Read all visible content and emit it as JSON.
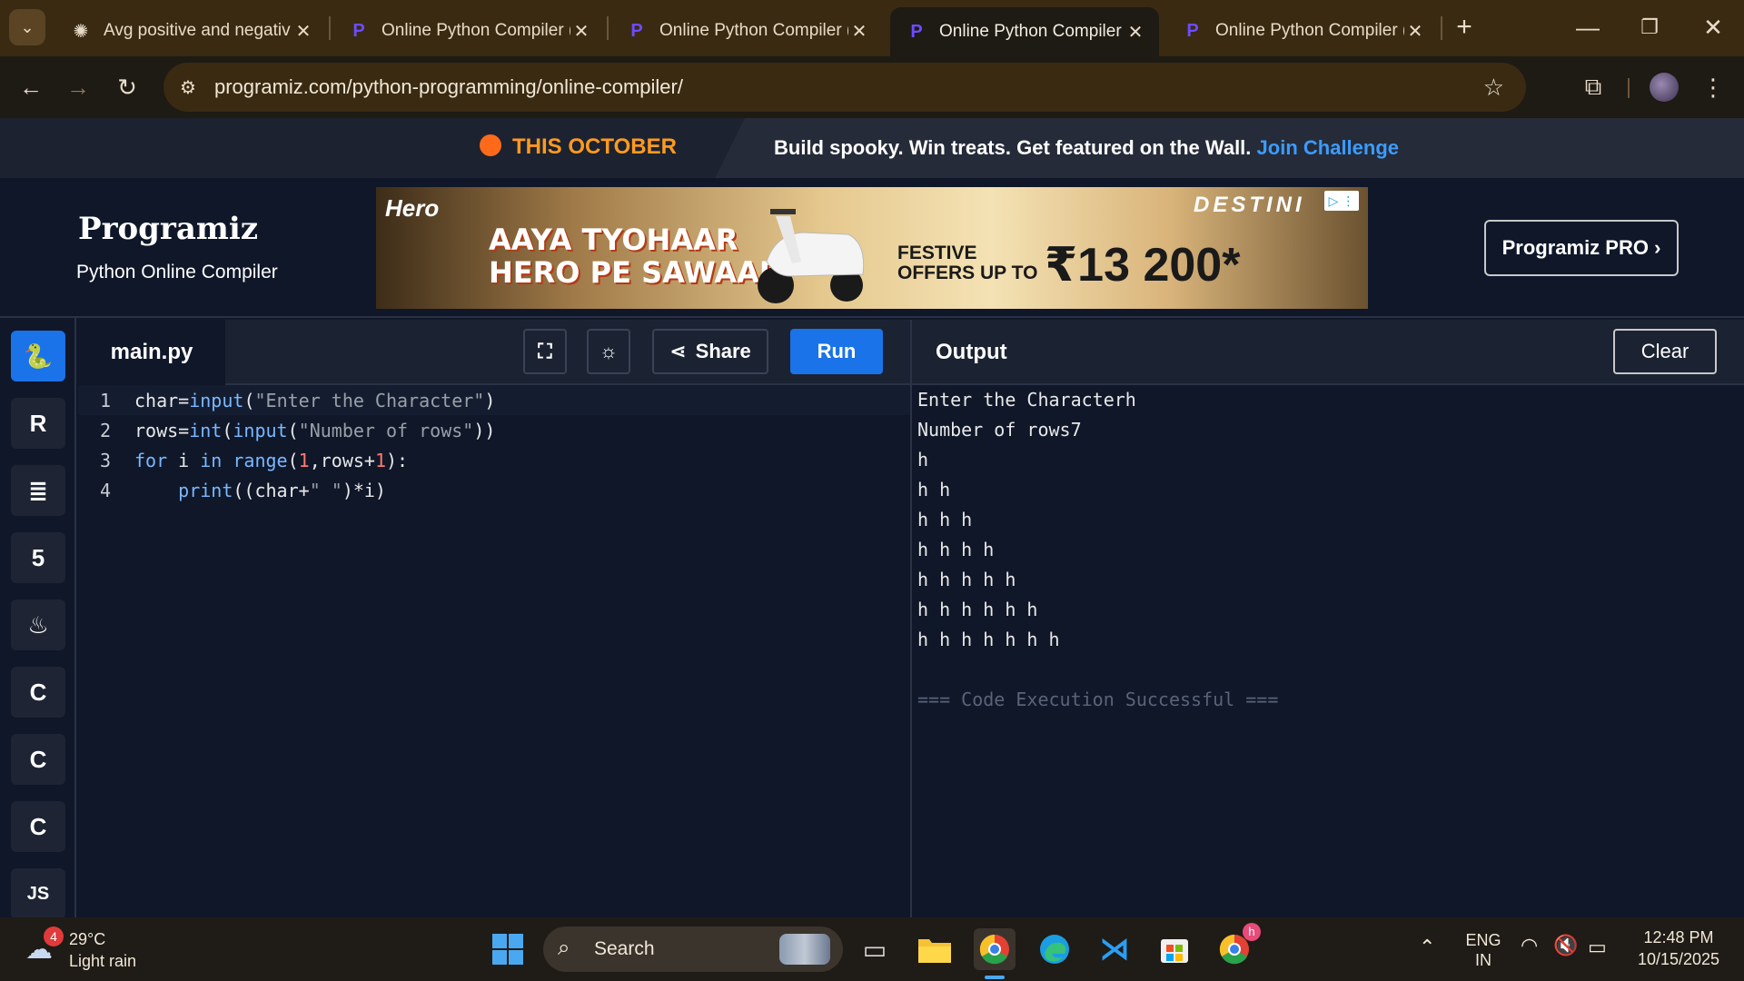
{
  "browser": {
    "tabs": [
      {
        "title": "Avg positive and negativ",
        "active": false
      },
      {
        "title": "Online Python Compiler (",
        "active": false
      },
      {
        "title": "Online Python Compiler (",
        "active": false
      },
      {
        "title": "Online Python Compiler (",
        "active": true
      },
      {
        "title": "Online Python Compiler (",
        "active": false
      }
    ],
    "url": "programiz.com/python-programming/online-compiler/"
  },
  "promo": {
    "headline": "THIS OCTOBER",
    "message": "Build spooky. Win treats. Get featured on the Wall.",
    "link": "Join Challenge"
  },
  "header": {
    "logo": "Programiz",
    "subtitle": "Python Online Compiler",
    "pro_button": "Programiz PRO ›"
  },
  "ad": {
    "brand_left": "Hero",
    "slogan_line1": "AAYA TYOHAAR",
    "slogan_line2": "HERO PE SAWAAR",
    "offer_line1": "FESTIVE",
    "offer_line2": "OFFERS UP TO",
    "price": "₹13 200*",
    "brand_right": "DESTINI",
    "adchoice": "▷ ⋮"
  },
  "sidebar": {
    "items": [
      {
        "icon": "python-icon",
        "glyph": "🐍",
        "active": true
      },
      {
        "icon": "r-icon",
        "glyph": "R",
        "active": false
      },
      {
        "icon": "database-icon",
        "glyph": "≣",
        "active": false
      },
      {
        "icon": "html5-icon",
        "glyph": "5",
        "active": false
      },
      {
        "icon": "java-icon",
        "glyph": "♨",
        "active": false
      },
      {
        "icon": "c-icon",
        "glyph": "C",
        "active": false
      },
      {
        "icon": "cpp-icon",
        "glyph": "C",
        "active": false
      },
      {
        "icon": "csharp-icon",
        "glyph": "C",
        "active": false
      },
      {
        "icon": "javascript-icon",
        "glyph": "JS",
        "active": false
      }
    ]
  },
  "editor": {
    "filename": "main.py",
    "share_label": "Share",
    "run_label": "Run",
    "lines": [
      {
        "n": "1",
        "code": "char=input(\"Enter the Character\")"
      },
      {
        "n": "2",
        "code": "rows=int(input(\"Number of rows\"))"
      },
      {
        "n": "3",
        "code": "for i in range(1,rows+1):"
      },
      {
        "n": "4",
        "code": "    print((char+\" \")*i)"
      }
    ]
  },
  "output": {
    "title": "Output",
    "clear_label": "Clear",
    "lines": [
      "Enter the Characterh",
      "Number of rows7",
      "h",
      "h h",
      "h h h",
      "h h h h",
      "h h h h h",
      "h h h h h h",
      "h h h h h h h",
      "",
      "=== Code Execution Successful ==="
    ]
  },
  "taskbar": {
    "weather_temp": "29°C",
    "weather_desc": "Light rain",
    "weather_badge": "4",
    "search_label": "Search",
    "lang_line1": "ENG",
    "lang_line2": "IN",
    "time": "12:48 PM",
    "date": "10/15/2025",
    "chrome_badge": "h"
  }
}
